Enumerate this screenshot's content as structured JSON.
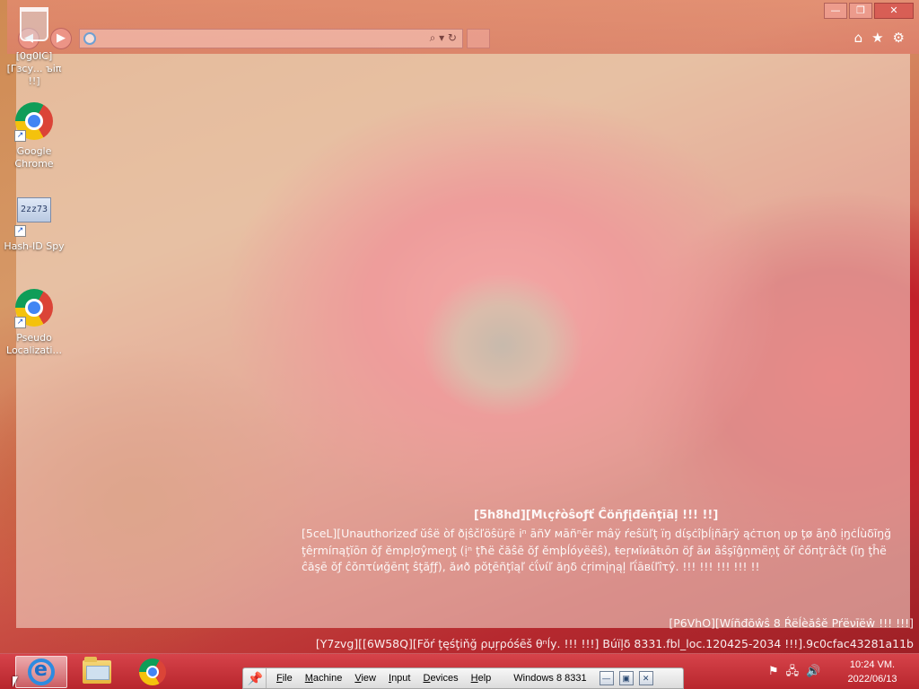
{
  "desktop": {
    "icons": [
      {
        "label": "[0g0IC][Гзсу... ъіπ !!]",
        "icon": "recycle-bin-icon"
      },
      {
        "label": "Google Chrome",
        "icon": "chrome-icon",
        "shortcut": true
      },
      {
        "label": "Hash-ID Spy",
        "icon": "hash-id-icon",
        "shortcut": true,
        "icon_text": "2zz73"
      },
      {
        "label": "Pseudo Localizati...",
        "icon": "chrome-icon",
        "shortcut": true
      }
    ]
  },
  "browser": {
    "window_controls": {
      "minimize": "—",
      "restore": "❐",
      "close": "✕"
    },
    "back_icon": "back-arrow-icon",
    "forward_icon": "forward-arrow-icon",
    "address": {
      "value": "",
      "tools": "⌕ ▾ ↻"
    },
    "toolbar_icons": [
      "⌂",
      "★",
      "⚙"
    ],
    "accent": "#e27a73"
  },
  "watermark": {
    "title": "[5h8hd][Mɩçṙòŝoƒť Ĉöñƒįđēñţĩāļ !!! !!]",
    "body": "[5ceL][Unauthorizeď ŭŝë òf ðįŝčľöŝüŗë іⁿ āñУ мāñⁿēr mâÿ ŕеŝüľţ ïŋ dίşċîþĺįñāŗÿ ąċтιоη υp ţø āņð ịŋċĺùδĩŋğ ţêŗmíпąţĭōп ŏƒ ĕmpļσŷmеŋţ (ịⁿ ţħё čăŝē ŏƒ ĕmþĺόуёēŝ), ŧеŗмĭиāŧιōп öƒ āи āŝşĩĝņmёņţ ŏř ĉőпţгâčŧ (ĭŋ ţĥё ĉăşē ŏƒ ĉŏпτίиğēпţ ŝţãƒƒ), ăиð рŏţēñţîąľ ċΐνίľ ăŋδ ċŗіmįηąļ ľΐāвίľîτŷ. !!! !!! !!! !!! !!",
    "release": "[P6VhO][Wíñđõŵŝ 8 Ŕëĺèăŝĕ Pŕёνīëŵ !!! !!!]",
    "build": "[Y7zvg][[6W58Q][Fŏŕ ţęśţіňğ ρџŗρóśēš θⁿĺу. !!! !!!] Βúïļδ 8331.fbl_loc.120425-2034 !!!].9c0cfac43281a11b"
  },
  "taskbar": {
    "color": "#c9333a",
    "pinned": [
      {
        "name": "internet-explorer",
        "active": true
      },
      {
        "name": "file-explorer",
        "active": false
      },
      {
        "name": "google-chrome",
        "active": false
      }
    ],
    "vm_menu": {
      "pin_icon": "pin-icon",
      "items": [
        {
          "first": "F",
          "rest": "ile"
        },
        {
          "first": "M",
          "rest": "achine"
        },
        {
          "first": "V",
          "rest": "iew"
        },
        {
          "first": "I",
          "rest": "nput"
        },
        {
          "first": "D",
          "rest": "evices"
        },
        {
          "first": "H",
          "rest": "elp"
        }
      ],
      "title": "Windows 8 8331",
      "controls": [
        "—",
        "▣",
        "✕"
      ]
    },
    "tray": {
      "flag": "⚑",
      "network": "🖧",
      "volume": "🔊"
    },
    "clock": {
      "time": "10:24 VM.",
      "date": "2022/06/13"
    }
  }
}
